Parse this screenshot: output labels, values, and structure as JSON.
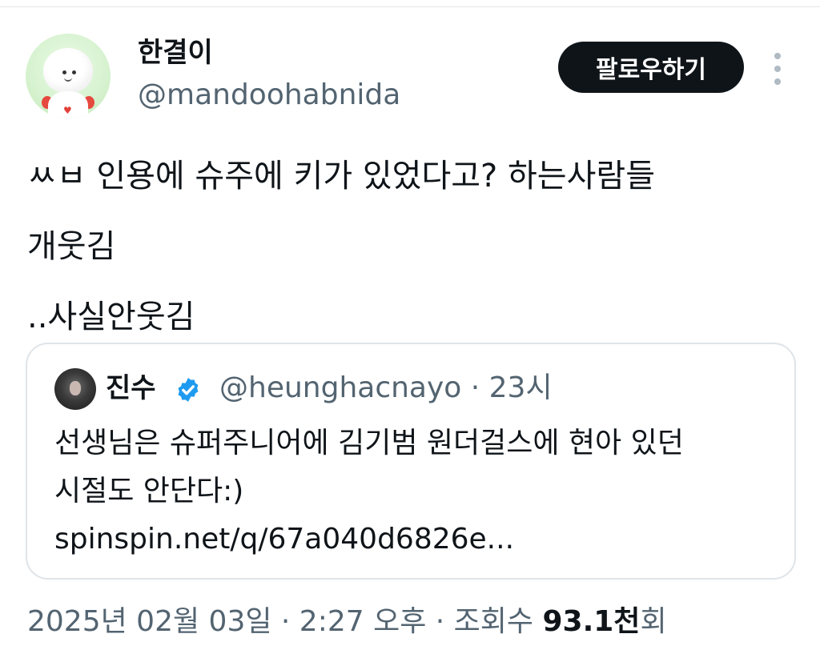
{
  "author": {
    "name": "한결이",
    "handle": "@mandoohabnida"
  },
  "follow_button_label": "팔로우하기",
  "tweet": {
    "text": "ㅆㅂ 인용에 슈주에 키가 있었다고? 하는사람들\n개웃김\n..사실안웃김"
  },
  "quoted_tweet": {
    "name": "진수",
    "meta": "@heunghacnayo · 23시",
    "text": "선생님은 슈퍼주니어에 김기범 원더걸스에 현아 있던\n시절도 안단다:)\nspinspin.net/q/67a040d6826e..."
  },
  "footer": {
    "datetime": "2025년 02월 03일 · 2:27 오후 · 조회수 ",
    "views_count": "93.1천",
    "views_suffix": "회"
  },
  "colors": {
    "text": "#0f1419",
    "secondary": "#536471",
    "verified": "#1d9bf0",
    "button_bg": "#0f1419"
  },
  "icons": [
    "more-options-icon",
    "verified-badge-icon"
  ]
}
